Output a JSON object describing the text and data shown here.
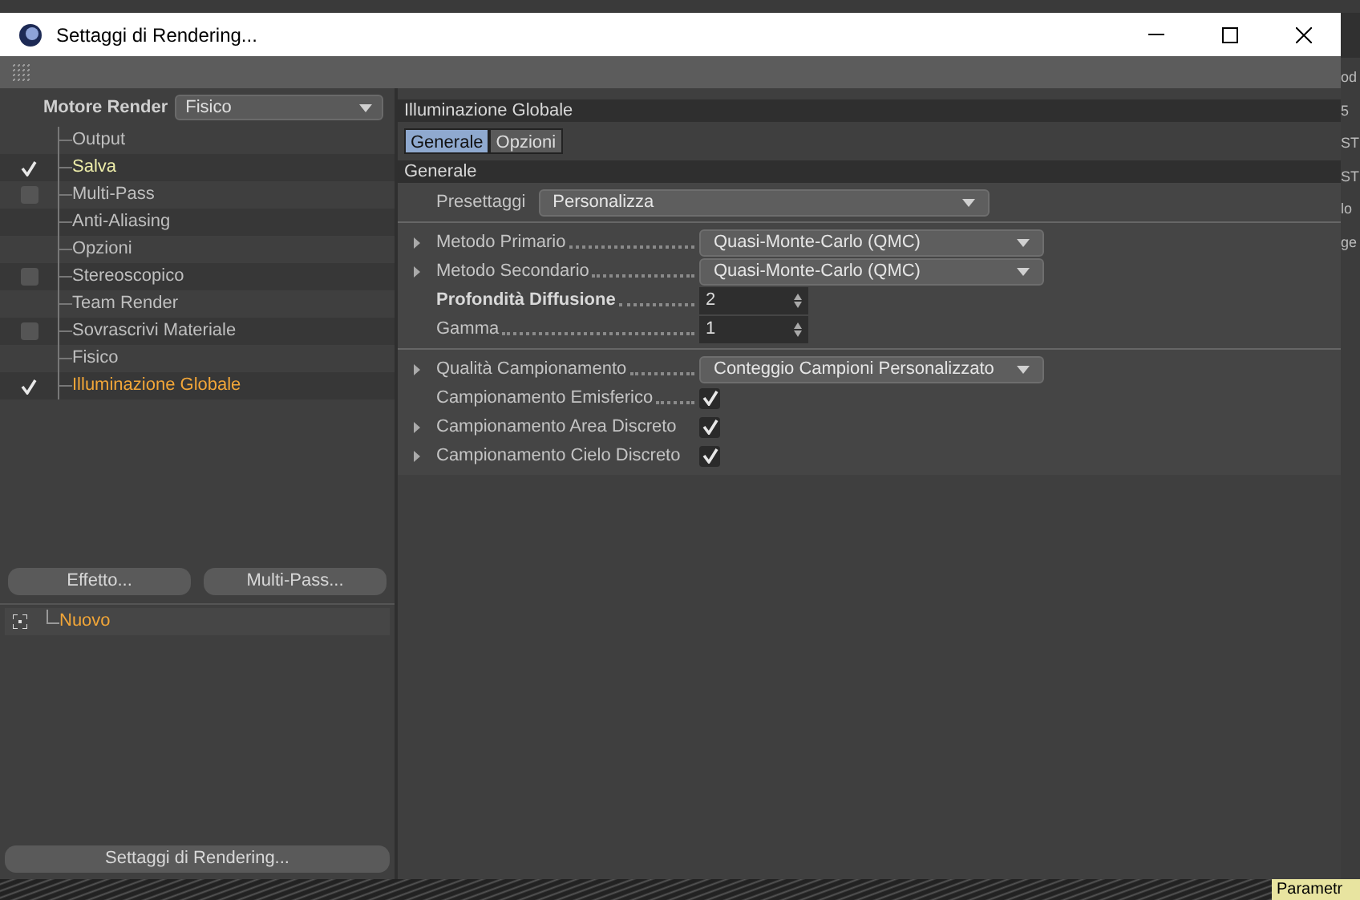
{
  "window": {
    "title": "Settaggi di Rendering..."
  },
  "engine": {
    "label": "Motore Render",
    "value": "Fisico"
  },
  "tree": [
    {
      "label": "Output",
      "kind": "plain",
      "selected": false,
      "highlighted": false
    },
    {
      "label": "Salva",
      "kind": "check",
      "checked": true,
      "selected": false,
      "highlighted": true
    },
    {
      "label": "Multi-Pass",
      "kind": "check",
      "checked": false,
      "selected": false,
      "highlighted": false
    },
    {
      "label": "Anti-Aliasing",
      "kind": "plain",
      "selected": false,
      "highlighted": false
    },
    {
      "label": "Opzioni",
      "kind": "plain",
      "selected": false,
      "highlighted": false
    },
    {
      "label": "Stereoscopico",
      "kind": "check",
      "checked": false,
      "selected": false,
      "highlighted": false
    },
    {
      "label": "Team Render",
      "kind": "plain",
      "selected": false,
      "highlighted": false
    },
    {
      "label": "Sovrascrivi Materiale",
      "kind": "check",
      "checked": false,
      "selected": false,
      "highlighted": false
    },
    {
      "label": "Fisico",
      "kind": "plain",
      "selected": false,
      "highlighted": false
    },
    {
      "label": "Illuminazione Globale",
      "kind": "check",
      "checked": true,
      "selected": true,
      "highlighted": false
    }
  ],
  "left_buttons": [
    "Effetto...",
    "Multi-Pass..."
  ],
  "presets": [
    {
      "label": "Nuovo"
    }
  ],
  "bottom_button": "Settaggi di Rendering...",
  "panel_title": "Illuminazione Globale",
  "tabs": [
    {
      "label": "Generale",
      "selected": true
    },
    {
      "label": "Opzioni",
      "selected": false
    }
  ],
  "section": "Generale",
  "groups": [
    [
      {
        "kind": "dropdown",
        "label": "Presettaggi",
        "leader": false,
        "value": "Personalizza",
        "expandable": false,
        "bold": false
      }
    ],
    [
      {
        "kind": "dropdown",
        "label": "Metodo Primario",
        "leader": true,
        "value": "Quasi-Monte-Carlo (QMC)",
        "expandable": true,
        "bold": false
      },
      {
        "kind": "dropdown",
        "label": "Metodo Secondario",
        "leader": true,
        "value": "Quasi-Monte-Carlo (QMC)",
        "expandable": true,
        "bold": false
      },
      {
        "kind": "number",
        "label": "Profondità Diffusione",
        "leader": true,
        "value": "2",
        "expandable": false,
        "bold": true
      },
      {
        "kind": "number",
        "label": "Gamma",
        "leader": true,
        "value": "1",
        "expandable": false,
        "bold": false
      }
    ],
    [
      {
        "kind": "dropdown",
        "label": "Qualità Campionamento",
        "leader": true,
        "value": "Conteggio Campioni Personalizzato",
        "expandable": true,
        "bold": false
      },
      {
        "kind": "checkbox",
        "label": "Campionamento Emisferico",
        "leader": true,
        "checked": true,
        "expandable": false,
        "bold": false
      },
      {
        "kind": "checkbox",
        "label": "Campionamento Area Discreto",
        "leader": false,
        "checked": true,
        "expandable": true,
        "bold": false
      },
      {
        "kind": "checkbox",
        "label": "Campionamento Cielo Discreto",
        "leader": false,
        "checked": true,
        "expandable": true,
        "bold": false
      }
    ]
  ],
  "background_fragments": [
    "od",
    "5",
    "ST",
    "ST",
    "lo",
    "ge"
  ],
  "background_tab": "Parametr"
}
